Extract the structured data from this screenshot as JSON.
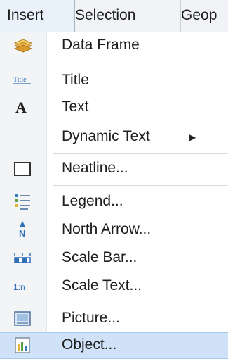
{
  "menubar": {
    "tabs": [
      {
        "label": "Insert"
      },
      {
        "label": "Selection"
      },
      {
        "label": "Geop"
      }
    ],
    "active_tab": "Insert"
  },
  "insert_menu": {
    "items": [
      {
        "label": "Data Frame",
        "icon": "data-frame-icon"
      },
      {
        "label": "Title",
        "icon": "title-icon",
        "icon_text": "Title"
      },
      {
        "label": "Text",
        "icon": "text-icon",
        "icon_text": "A"
      },
      {
        "label": "Dynamic Text",
        "icon": null,
        "submenu": true,
        "submenu_glyph": "▶"
      },
      {
        "label": "Neatline...",
        "icon": "neatline-icon"
      },
      {
        "label": "Legend...",
        "icon": "legend-icon"
      },
      {
        "label": "North Arrow...",
        "icon": "north-arrow-icon",
        "icon_text": "N"
      },
      {
        "label": "Scale Bar...",
        "icon": "scale-bar-icon"
      },
      {
        "label": "Scale Text...",
        "icon": "scale-text-icon",
        "icon_text": "1:n"
      },
      {
        "label": "Picture...",
        "icon": "picture-icon"
      },
      {
        "label": "Object...",
        "icon": "object-icon",
        "highlighted": true
      }
    ]
  },
  "colors": {
    "menu_highlight": "#cfe2f7",
    "gutter": "#f3f4f6",
    "icon_blue": "#2f6fb7",
    "icon_yellow": "#e9b43a"
  }
}
